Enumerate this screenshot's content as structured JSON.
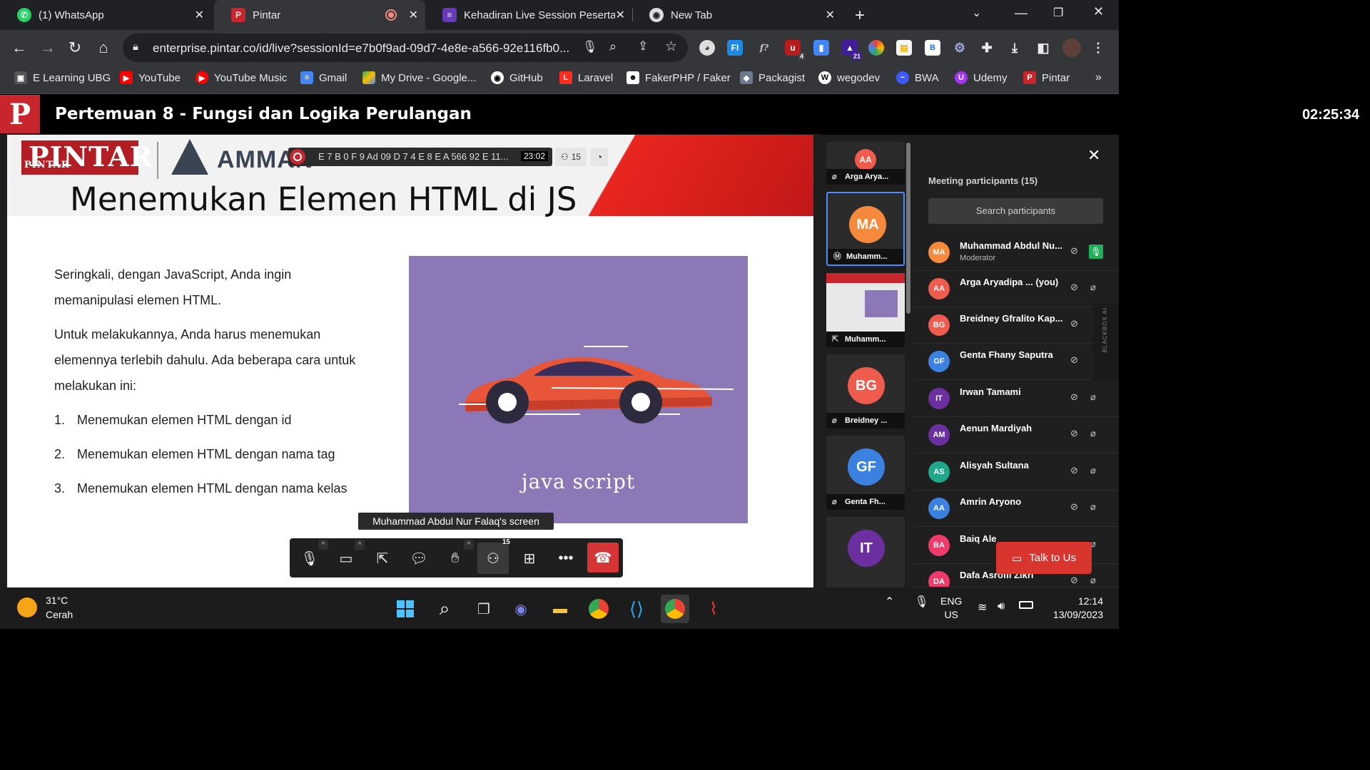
{
  "browser": {
    "tabs": [
      {
        "label": "(1) WhatsApp",
        "icon": "whatsapp-icon",
        "color": "#25d366"
      },
      {
        "label": "Pintar",
        "icon": "pintar-icon",
        "color": "#c8262c"
      },
      {
        "label": "Kehadiran Live Session Peserta D",
        "icon": "forms-icon",
        "color": "#673ab7"
      },
      {
        "label": "New Tab",
        "icon": "chrome-icon",
        "color": "#9aa0a6"
      }
    ],
    "url": "enterprise.pintar.co/id/live?sessionId=e7b0f9ad-09d7-4e8e-a566-92e116fb0...",
    "ext_badges": {
      "ublock": "4",
      "counter": "21"
    },
    "bookmarks": [
      {
        "label": "E Learning UBG",
        "color": "#555"
      },
      {
        "label": "YouTube",
        "color": "#ff0000"
      },
      {
        "label": "YouTube Music",
        "color": "#ff0000"
      },
      {
        "label": "Gmail",
        "color": "#4285f4"
      },
      {
        "label": "My Drive - Google...",
        "color": "#fbbc04"
      },
      {
        "label": "GitHub",
        "color": "#333"
      },
      {
        "label": "Laravel",
        "color": "#ff2d20"
      },
      {
        "label": "FakerPHP / Faker",
        "color": "#555"
      },
      {
        "label": "Packagist",
        "color": "#6b7a8f"
      },
      {
        "label": "wegodev",
        "color": "#333"
      },
      {
        "label": "BWA",
        "color": "#3d5afe"
      },
      {
        "label": "Udemy",
        "color": "#a435f0"
      },
      {
        "label": "Pintar",
        "color": "#c8262c"
      }
    ]
  },
  "meeting": {
    "logo": "P",
    "title": "Pertemuan 8 - Fungsi dan Logika Perulangan",
    "clock": "02:25:34",
    "session_code": "E 7 B 0 F 9 Ad 09 D 7 4 E 8 E A 566 92 E 11...",
    "session_time": "23:02",
    "participant_count": "15",
    "screen_label": "Muhammad Abdul Nur Falaq's screen",
    "participants_badge": "15"
  },
  "slide": {
    "brand_main": "PINTAR",
    "brand_sub": "PINTAR",
    "brand2": "AMMAN",
    "title": "Menemukan Elemen HTML di JS",
    "para1_line1": "Seringkali, dengan JavaScript, Anda ingin",
    "para1_line2": "memanipulasi elemen HTML.",
    "para2_line1": "Untuk melakukannya, Anda harus menemukan",
    "para2_line2": "elemennya terlebih dahulu. Ada beberapa cara untuk",
    "para2_line3": "melakukan ini:",
    "list": [
      {
        "n": "1.",
        "text": "Menemukan elemen HTML dengan id"
      },
      {
        "n": "2.",
        "text": "Menemukan elemen HTML dengan nama tag"
      },
      {
        "n": "3.",
        "text": "Menemukan elemen HTML dengan nama kelas"
      }
    ],
    "image_label": "java script"
  },
  "thumbnails": [
    {
      "initials": "AA",
      "name": "Arga Arya...",
      "color": "#ef5b4c"
    },
    {
      "initials": "MA",
      "name": "Muhamm...",
      "color": "#f68a3c"
    },
    {
      "initials": "",
      "name": "Muhamm...",
      "color": "#2b2b2b"
    },
    {
      "initials": "BG",
      "name": "Breidney ...",
      "color": "#ef5b4c"
    },
    {
      "initials": "GF",
      "name": "Genta Fh...",
      "color": "#3b82e0"
    },
    {
      "initials": "IT",
      "name": "",
      "color": "#6b2fa0"
    }
  ],
  "panel": {
    "title": "Meeting participants (15)",
    "search_placeholder": "Search participants",
    "participants": [
      {
        "initials": "MA",
        "name": "Muhammad Abdul Nu...",
        "role": "Moderator",
        "color": "#f68a3c"
      },
      {
        "initials": "AA",
        "name": "Arga Aryadipa ...  (you)",
        "role": "",
        "color": "#ef5b4c"
      },
      {
        "initials": "BG",
        "name": "Breidney Gfralito Kap...",
        "role": "",
        "color": "#ef5b4c"
      },
      {
        "initials": "GF",
        "name": "Genta Fhany Saputra",
        "role": "",
        "color": "#3b82e0"
      },
      {
        "initials": "IT",
        "name": "Irwan Tamami",
        "role": "",
        "color": "#6b2fa0"
      },
      {
        "initials": "AM",
        "name": "Aenun Mardiyah",
        "role": "",
        "color": "#6b2fa0"
      },
      {
        "initials": "AS",
        "name": "Alisyah Sultana",
        "role": "",
        "color": "#1fa88a"
      },
      {
        "initials": "AA",
        "name": "Amrin Aryono",
        "role": "",
        "color": "#3b82e0"
      },
      {
        "initials": "BA",
        "name": "Baiq Ale",
        "role": "",
        "color": "#ef3b6b"
      },
      {
        "initials": "DA",
        "name": "Dafa Asrofil Zikri",
        "role": "",
        "color": "#ef3b6b"
      }
    ],
    "talk_button": "Talk to Us",
    "side_label": "BLACKBOX AI"
  },
  "taskbar": {
    "temperature": "31°C",
    "condition": "Cerah",
    "lang1": "ENG",
    "lang2": "US",
    "time": "12:14",
    "date": "13/09/2023"
  }
}
